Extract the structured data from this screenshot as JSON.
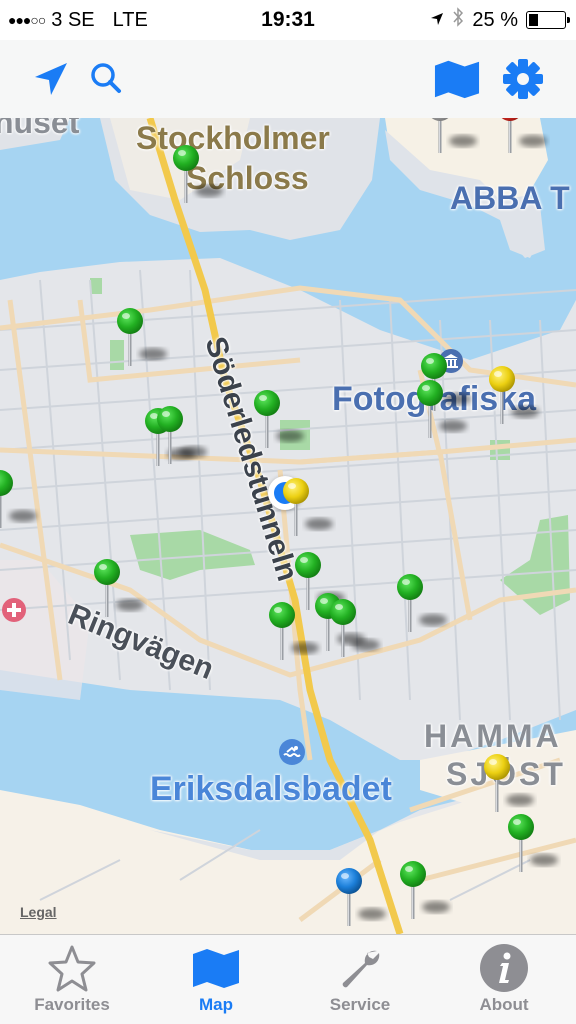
{
  "status_bar": {
    "signal_dots": "●●●○○",
    "carrier": "3 SE",
    "network": "LTE",
    "time": "19:31",
    "battery_text": "25 %",
    "battery_level": 0.25
  },
  "nav_bar": {
    "left_icons": [
      "location-arrow-icon",
      "search-icon"
    ],
    "right_icons": [
      "map-icon",
      "gear-icon"
    ]
  },
  "colors": {
    "accent": "#1a7cf5",
    "water": "#a6d4f2",
    "land": "#e4e6ea",
    "park": "#a8d9a6",
    "pin_green": "#2fbf2f",
    "pin_yellow": "#f1d40f",
    "pin_blue": "#1c7fd9",
    "pin_red": "#e8322a"
  },
  "map": {
    "labels": {
      "stadshuset_fragment": "huset",
      "stockholmer": "Stockholmer",
      "schloss": "Schloss",
      "abba": "ABBA T",
      "fotografiska": "Fotografiska",
      "soderledstunneln": "Söderledstunneln",
      "ringvagen": "Ringvägen",
      "hammarby": "HAMMA",
      "sjostad": "SJÖST",
      "eriksdalsbadet": "Eriksdalsbadet"
    },
    "legal": "Legal",
    "pins": [
      {
        "color": "green",
        "name": "pin-stockholmer-schloss"
      },
      {
        "color": "grey",
        "name": "pin-top-right-1"
      },
      {
        "color": "red",
        "name": "pin-top-right-2"
      },
      {
        "color": "green",
        "name": "pin-1"
      },
      {
        "color": "green",
        "name": "pin-2"
      },
      {
        "color": "green",
        "name": "pin-3"
      },
      {
        "color": "green",
        "name": "pin-4"
      },
      {
        "color": "green",
        "name": "pin-fotografiska-1"
      },
      {
        "color": "green",
        "name": "pin-fotografiska-2"
      },
      {
        "color": "yellow",
        "name": "pin-fotografiska-3"
      },
      {
        "color": "green",
        "name": "pin-left-edge"
      },
      {
        "color": "yellow",
        "name": "pin-current-location"
      },
      {
        "color": "green",
        "name": "pin-5"
      },
      {
        "color": "green",
        "name": "pin-ringvagen"
      },
      {
        "color": "green",
        "name": "pin-6"
      },
      {
        "color": "green",
        "name": "pin-7"
      },
      {
        "color": "green",
        "name": "pin-8"
      },
      {
        "color": "green",
        "name": "pin-9"
      },
      {
        "color": "yellow",
        "name": "pin-hammarby"
      },
      {
        "color": "green",
        "name": "pin-10"
      },
      {
        "color": "blue",
        "name": "pin-bottom-blue"
      },
      {
        "color": "green",
        "name": "pin-11"
      }
    ]
  },
  "tab_bar": {
    "tabs": [
      {
        "label": "Favorites",
        "icon": "star-icon",
        "active": false
      },
      {
        "label": "Map",
        "icon": "map-icon",
        "active": true
      },
      {
        "label": "Service",
        "icon": "wrench-icon",
        "active": false
      },
      {
        "label": "About",
        "icon": "info-icon",
        "active": false
      }
    ]
  }
}
